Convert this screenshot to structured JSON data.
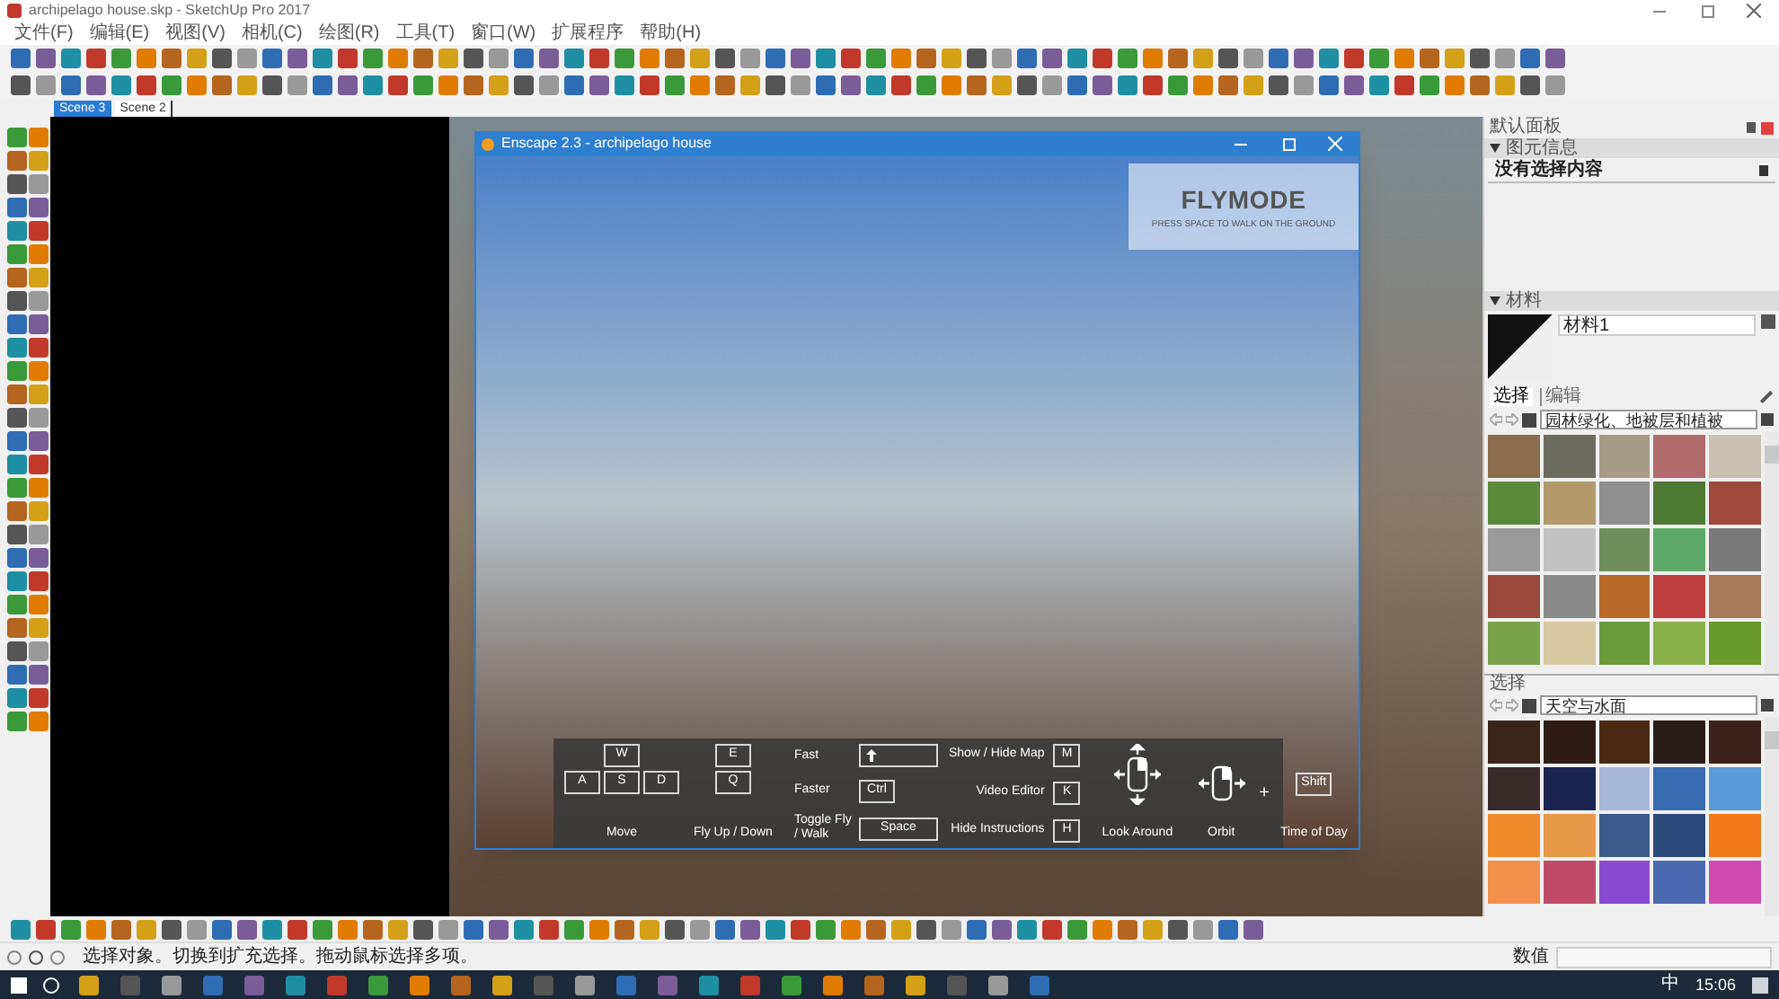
{
  "title_bar": {
    "title": "archipelago house.skp - SketchUp Pro 2017"
  },
  "menu": [
    "文件(F)",
    "编辑(E)",
    "视图(V)",
    "相机(C)",
    "绘图(R)",
    "工具(T)",
    "窗口(W)",
    "扩展程序",
    "帮助(H)"
  ],
  "scene_tabs": [
    {
      "label": "Scene 3",
      "selected": true
    },
    {
      "label": "Scene 2",
      "selected": false
    }
  ],
  "enscape": {
    "title": "Enscape 2.3 - archipelago house",
    "flymode": {
      "title": "FLYMODE",
      "subtitle": "PRESS SPACE TO WALK ON THE GROUND"
    },
    "instructions": {
      "move_keys": [
        "W",
        "A",
        "S",
        "D"
      ],
      "move_label": "Move",
      "fly_keys": [
        "E",
        "Q"
      ],
      "fly_label": "Fly Up / Down",
      "speed_rows": [
        {
          "label": "Fast",
          "kind": "shift-icon"
        },
        {
          "label": "Faster",
          "kind": "text",
          "key": "Ctrl"
        },
        {
          "label": "Toggle Fly / Walk",
          "kind": "wide",
          "key": "Space"
        }
      ],
      "map_rows": [
        {
          "label": "Show / Hide Map",
          "key": "M"
        },
        {
          "label": "Video Editor",
          "key": "K"
        },
        {
          "label": "Hide Instructions",
          "key": "H"
        }
      ],
      "look_label": "Look Around",
      "orbit_label": "Orbit",
      "plus": "+",
      "time_key": "Shift",
      "time_label": "Time of Day"
    }
  },
  "tray": {
    "title": "默认面板",
    "entity_info": {
      "title": "图元信息",
      "text": "没有选择内容"
    },
    "materials": {
      "title": "材料",
      "name": "材料1",
      "tabs": [
        {
          "label": "选择",
          "selected": true
        },
        {
          "label": "编辑",
          "selected": false
        }
      ],
      "library": "园林绿化、地被层和植被"
    },
    "second": {
      "title": "选择",
      "library": "天空与水面"
    }
  },
  "status_bar": {
    "message": "选择对象。切换到扩充选择。拖动鼠标选择多项。",
    "measurements_label": "数值"
  },
  "taskbar": {
    "ime": "中",
    "time": "15:06"
  }
}
